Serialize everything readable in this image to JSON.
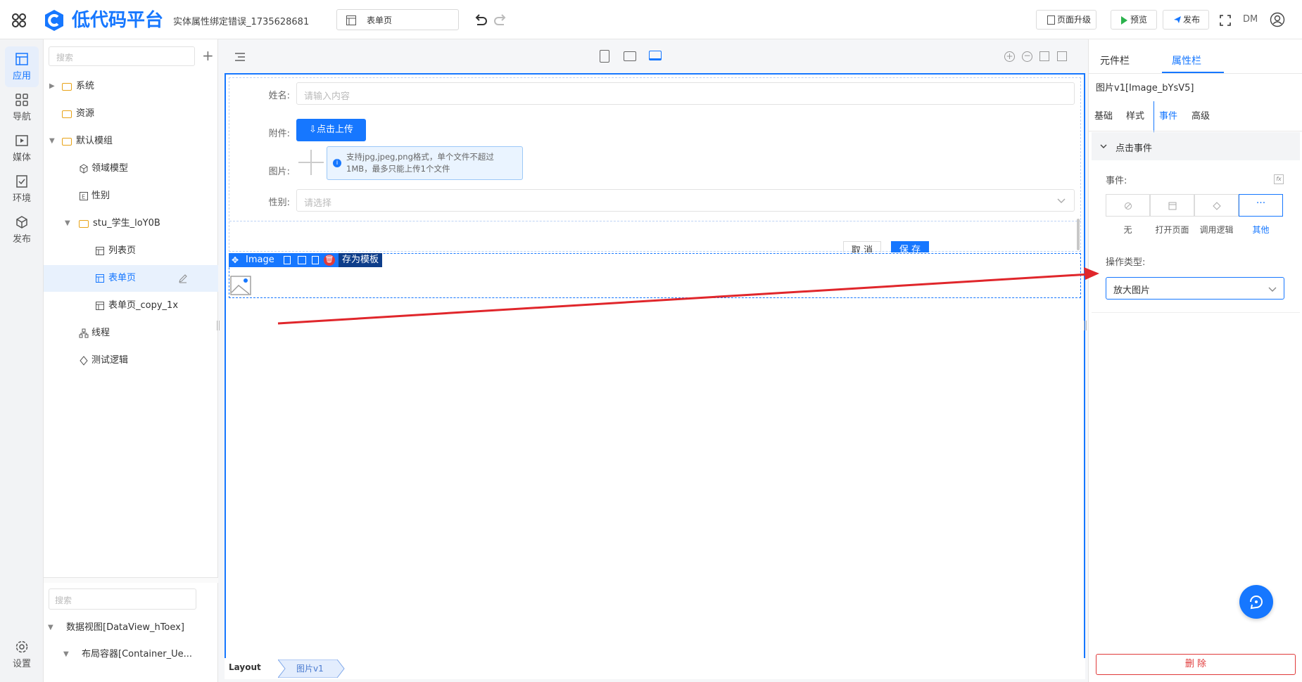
{
  "app": {
    "name": "低代码平台",
    "project": "实体属性绑定错误_1735628681",
    "page_selector": "表单页",
    "user": "DM"
  },
  "toolbar": {
    "upgrade": "页面升级",
    "preview": "预览",
    "publish": "发布"
  },
  "leftnav": [
    {
      "label": "应用"
    },
    {
      "label": "导航"
    },
    {
      "label": "媒体"
    },
    {
      "label": "环境"
    },
    {
      "label": "发布"
    },
    {
      "label": "设置"
    }
  ],
  "tree": {
    "search_placeholder": "搜索",
    "items": [
      {
        "label": "系统"
      },
      {
        "label": "资源"
      },
      {
        "label": "默认模组"
      },
      {
        "label": "领域模型"
      },
      {
        "label": "性别"
      },
      {
        "label": "stu_学生_loY0B"
      },
      {
        "label": "列表页"
      },
      {
        "label": "表单页"
      },
      {
        "label": "表单页_copy_1x"
      },
      {
        "label": "线程"
      },
      {
        "label": "测试逻辑"
      }
    ],
    "bottom_search_placeholder": "搜索",
    "bottom_items": [
      {
        "label": "数据视图[DataView_hToex]"
      },
      {
        "label": "布局容器[Container_Ue..."
      }
    ]
  },
  "form": {
    "name_label": "姓名:",
    "name_placeholder": "请输入内容",
    "attach_label": "附件:",
    "upload_btn": "点击上传",
    "image_label": "图片:",
    "image_hint": "支持jpg,jpeg,png格式，单个文件不超过1MB，最多只能上传1个文件",
    "gender_label": "性别:",
    "gender_placeholder": "请选择",
    "cancel": "取 消",
    "save": "保 存"
  },
  "selection": {
    "component": "Image",
    "save_template": "存为模板"
  },
  "breadcrumb": {
    "root": "Layout",
    "current": "图片v1"
  },
  "right": {
    "tab_components": "元件栏",
    "tab_props": "属性栏",
    "element_title": "图片v1[Image_bYsV5]",
    "subtabs": [
      {
        "label": "基础"
      },
      {
        "label": "样式"
      },
      {
        "label": "事件"
      },
      {
        "label": "高级"
      }
    ],
    "section": "点击事件",
    "event_label": "事件:",
    "events": [
      {
        "label": "无"
      },
      {
        "label": "打开页面"
      },
      {
        "label": "调用逻辑"
      },
      {
        "label": "其他"
      }
    ],
    "op_label": "操作类型:",
    "op_value": "放大图片",
    "delete": "删 除"
  },
  "colors": {
    "primary": "#1677ff",
    "arrow": "#e0262b",
    "delete": "#e03a3a"
  }
}
